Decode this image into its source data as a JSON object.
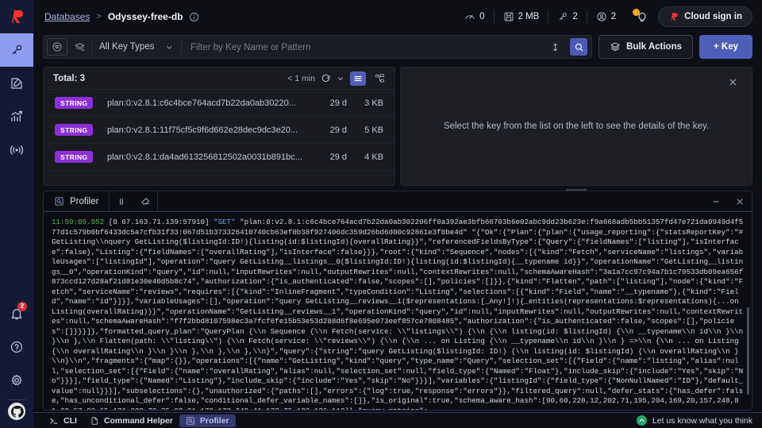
{
  "sidebar": {
    "logo": "redis-logo-icon",
    "items": [
      {
        "name": "browser",
        "icon": "key-icon",
        "active": true
      },
      {
        "name": "workbench",
        "icon": "edit-square-icon",
        "active": false
      },
      {
        "name": "analysis",
        "icon": "bar-chart-icon",
        "active": false
      },
      {
        "name": "pubsub",
        "icon": "broadcast-icon",
        "active": false
      }
    ],
    "bottom": [
      {
        "name": "notifications",
        "icon": "bell-icon",
        "badge": "2"
      },
      {
        "name": "help",
        "icon": "question-circle-icon",
        "badge": ""
      },
      {
        "name": "settings",
        "icon": "gear-icon",
        "badge": ""
      }
    ],
    "github": "github-icon"
  },
  "header": {
    "breadcrumb_root": "Databases",
    "breadcrumb_sep": ">",
    "breadcrumb_current": "Odyssey-free-db",
    "info_icon": "info-circle-icon",
    "stats": [
      {
        "icon": "speedometer-icon",
        "value": "0"
      },
      {
        "icon": "database-icon",
        "value": "2 MB"
      },
      {
        "icon": "key-icon",
        "value": "2"
      },
      {
        "icon": "user-icon",
        "value": "2"
      }
    ],
    "tips_icon": "lightbulb-icon",
    "cloud_button": "Cloud sign in",
    "cloud_button_icon": "redis-mark-icon"
  },
  "toolbar": {
    "view_icon": "filter-list-icon",
    "bulk_icon": "stack-delete-icon",
    "key_type_label": "All Key Types",
    "key_type_caret": "chevron-down-icon",
    "filter_placeholder": "Filter by Key Name or Pattern",
    "filter_value": "",
    "resize_icon": "arrows-vertical-icon",
    "search_icon": "search-icon",
    "bulk_actions_label": "Bulk Actions",
    "bulk_actions_icon": "layers-icon",
    "add_key_label": "+ Key"
  },
  "keys_panel": {
    "total_label": "Total: 3",
    "refresh_label": "< 1 min",
    "refresh_icon": "refresh-icon",
    "refresh_caret": "chevron-down-icon",
    "view_list_icon": "list-view-icon",
    "view_tree_icon": "tree-view-icon",
    "rows": [
      {
        "type": "STRING",
        "name": "plan:0:v2.8.1:c6c4bce764acd7b22da0ab30220...",
        "ttl": "29 d",
        "size": "3 KB"
      },
      {
        "type": "STRING",
        "name": "plan:0:v2.8.1:11f75cf5c9f6d662e28dec9dc3e20...",
        "ttl": "29 d",
        "size": "5 KB"
      },
      {
        "type": "STRING",
        "name": "plan:0:v2.8.1:da4ad613256812502a0031b891bc...",
        "ttl": "29 d",
        "size": "4 KB"
      }
    ]
  },
  "detail_panel": {
    "message": "Select the key from the list on the left to see the details of the key.",
    "close_icon": "close-icon"
  },
  "profiler": {
    "tab_label": "Profiler",
    "tab_icon": "profiler-icon",
    "pause_icon": "pause-icon",
    "clear_icon": "eraser-icon",
    "minimize_icon": "minimize-icon",
    "close_icon": "close-icon",
    "log_timestamp": "11:59:09.952",
    "log_client": "[0 67.163.71.139:57910]",
    "log_command": "\"SET\"",
    "log_body": " \"plan:0:v2.8.1:c6c4bce764acd7b22da0ab302206ff0a392ae3bfb66703b6e02abc9dd23b623e:f9a668adb5bb51357fd47e721da0949d4f577d1c579b0bf6433dc5a7cfb31f33:067d51b373326410740cb63ef0b38f927406dc359d26bd6d00c92861e3f0be4d\" \"{\"Ok\":{\"Plan\":{\"plan\":{\"usage_reporting\":{\"statsReportKey\":\"# GetListing\\\\nquery GetListing($listingId:ID!){listing(id:$listingId){overallRating}}\",\"referencedFieldsByType\":{\"Query\":{\"fieldNames\":[\"listing\"],\"isInterface\":false},\"Listing\":{\"fieldNames\":[\"overallRating\"],\"isInterface\":false}}},\"root\":{\"kind\":\"Sequence\",\"nodes\":[{\"kind\":\"Fetch\",\"serviceName\":\"listings\",\"variableUsages\":[\"listingId\"],\"operation\":\"query GetListing__listings__0($listingId:ID!){listing(id:$listingId){__typename id}}\",\"operationName\":\"GetListing__listings__0\",\"operationKind\":\"query\",\"id\":null,\"inputRewrites\":null,\"outputRewrites\":null,\"contextRewrites\":null,\"schemaAwareHash\":\"3a1a7cc97c94a7b1c79533db09ea656f873ccd127d28af21d81e30e40d5b8c74\",\"authorization\":{\"is_authenticated\":false,\"scopes\":[],\"policies\":[]}},{\"kind\":\"Flatten\",\"path\":[\"listing\"],\"node\":{\"kind\":\"Fetch\",\"serviceName\":\"reviews\",\"requires\":[{\"kind\":\"InlineFragment\",\"typeCondition\":\"Listing\",\"selections\":[{\"kind\":\"Field\",\"name\":\"__typename\"},{\"kind\":\"Field\",\"name\":\"id\"}]}],\"variableUsages\":[],\"operation\":\"query GetListing__reviews__1($representations:[_Any!]!){_entities(representations:$representations){...on Listing(overallRating)}}\",\"operationName\":\"GetListing__reviews__1\",\"operationKind\":\"query\",\"id\":null,\"inputRewrites\":null,\"outputRewrites\":null,\"contextRewrites\":null,\"schemaAwareHash\":\"f7f2bbd8107598ec3a7fcf6fe15b53e53d208d6f8e695e073eef857ce7808485\",\"authorization\":{\"is_authenticated\":false,\"scopes\":[],\"policies\":[]}}}]},\"formatted_query_plan\":\"QueryPlan {\\\\n Sequence {\\\\n Fetch(service: \\\\\"listings\\\\\") {\\\\n {\\\\n listing(id: $listingId) {\\\\n __typename\\\\n id\\\\n }\\\\n }\\\\n },\\\\n Flatten(path: \\\\\"listing\\\\\") {\\\\n Fetch(service: \\\\\"reviews\\\\\") {\\\\n {\\\\n ... on Listing {\\\\n __typename\\\\n id\\\\n }\\\\n } =>\\\\n {\\\\n ... on Listing {\\\\n overallRating\\\\n }\\\\n }\\\\n },\\\\n },\\\\n },\\\\n}\",\"query\":{\"string\":\"query GetListing($listingId: ID!) {\\\\n listing(id: $listingId) {\\\\n overallRating\\\\n }\\\\n}\\\\n\",\"fragments\":{\"map\":{}},\"operations\":[{\"name\":\"GetListing\",\"kind\":\"query\",\"type_name\":\"Query\",\"selection_set\":[{\"Field\":{\"name\":\"listing\",\"alias\":null,\"selection_set\":[{\"Field\":{\"name\":\"overallRating\",\"alias\":null,\"selection_set\":null,\"field_type\":{\"Named\":\"Float\"},\"include_skip\":{\"include\":\"Yes\",\"skip\":\"No\"}}}],\"field_type\":{\"Named\":\"Listing\"},\"include_skip\":{\"include\":\"Yes\",\"skip\":\"No\"}}}],\"variables\":{\"listingId\":{\"field_type\":{\"NonNullNamed\":\"ID\"},\"default_value\":null}}}],\"subselections\":{},\"unauthorized\":{\"paths\":[],\"errors\":{\"log\":true,\"response\":\"errors\"}},\"filtered_query\":null,\"defer_stats\":{\"has_defer\":false,\"has_unconditional_defer\":false,\"conditional_defer_variable_names\":[]},\"is_original\":true,\"schema_aware_hash\":[90,60,228,12,202,71,195,204,169,20,157,248,81,28,57,90,65,171,228,79,35,88,21,179,172,249,41,172,75,128,126,110]},\"query_metrics\":"
  },
  "statusbar": {
    "cli_label": "CLI",
    "cli_icon": "terminal-icon",
    "helper_label": "Command Helper",
    "helper_icon": "document-icon",
    "profiler_label": "Profiler",
    "profiler_icon": "profiler-icon",
    "feedback_label": "Let us know what you think",
    "feedback_icon": "feedback-icon"
  },
  "colors": {
    "accent": "#4f5fb8",
    "sidebar": "#141a35",
    "string_badge": "#8b2fd6",
    "brand_red": "#f0342b"
  }
}
